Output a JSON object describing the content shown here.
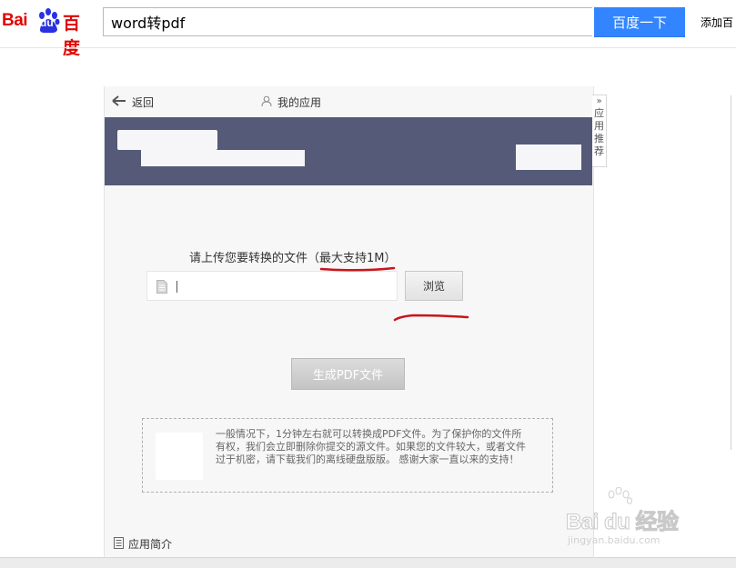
{
  "header": {
    "logo_text_latin": "Bai",
    "logo_text_du": "du",
    "logo_text_cn": "百度",
    "search_value": "word转pdf",
    "search_button": "百度一下",
    "add_link": "添加百"
  },
  "panel": {
    "back_label": "返回",
    "my_apps_label": "我的应用",
    "upload_prompt": "请上传您要转换的文件",
    "upload_limit": "（最大支持1M）",
    "file_input_value": "",
    "browse_button": "浏览",
    "generate_button": "生成PDF文件",
    "notice_text": "一般情况下，1分钟左右就可以转换成PDF文件。为了保护你的文件所有权，我们会立即删除你提交的源文件。如果您的文件较大，或者文件过于机密，请下载我们的离线硬盘版版。 感谢大家一直以来的支持！",
    "intro_label": "应用简介"
  },
  "side_tab": {
    "arrows": "»",
    "label": "应用推荐"
  },
  "watermark": {
    "text": "Bai du 经验",
    "url": "jingyan.baidu.com"
  },
  "colors": {
    "brand_red": "#e10602",
    "search_blue": "#3385ff",
    "banner": "#545a78",
    "annotation": "#c8151b"
  }
}
